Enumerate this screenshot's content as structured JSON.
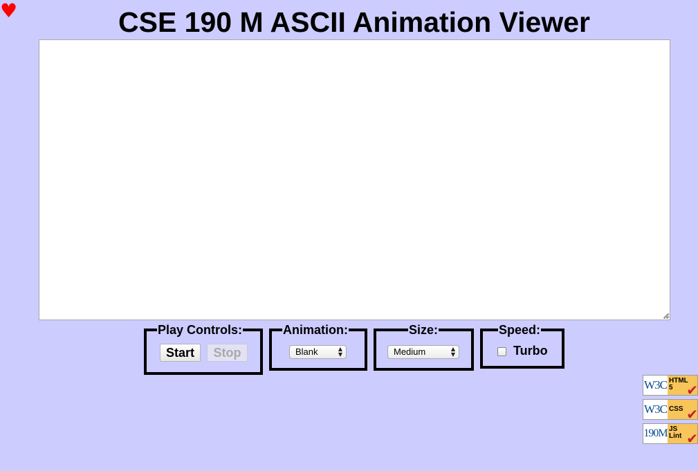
{
  "heart_glyph": "♥",
  "title": "CSE 190 M ASCII Animation Viewer",
  "textarea": {
    "value": ""
  },
  "play_controls": {
    "legend": "Play Controls:",
    "start_label": "Start",
    "stop_label": "Stop",
    "stop_disabled": true
  },
  "animation": {
    "legend": "Animation:",
    "selected": "Blank"
  },
  "size": {
    "legend": "Size:",
    "selected": "Medium"
  },
  "speed": {
    "legend": "Speed:",
    "turbo_label": "Turbo",
    "turbo_checked": false
  },
  "badges": [
    {
      "left_text": "W3C",
      "right_line1": "HTML",
      "right_line2": "5",
      "icon": "checkmark-icon"
    },
    {
      "left_text": "W3C",
      "right_line1": "CSS",
      "right_line2": "",
      "icon": "checkmark-icon"
    },
    {
      "left_text": "190M",
      "right_line1": "JS",
      "right_line2": "Lint",
      "icon": "checkmark-icon"
    }
  ],
  "colors": {
    "background": "#ccccff",
    "heart": "#ff0000",
    "badge_accent": "#f8c55a",
    "check": "#c0242a"
  }
}
